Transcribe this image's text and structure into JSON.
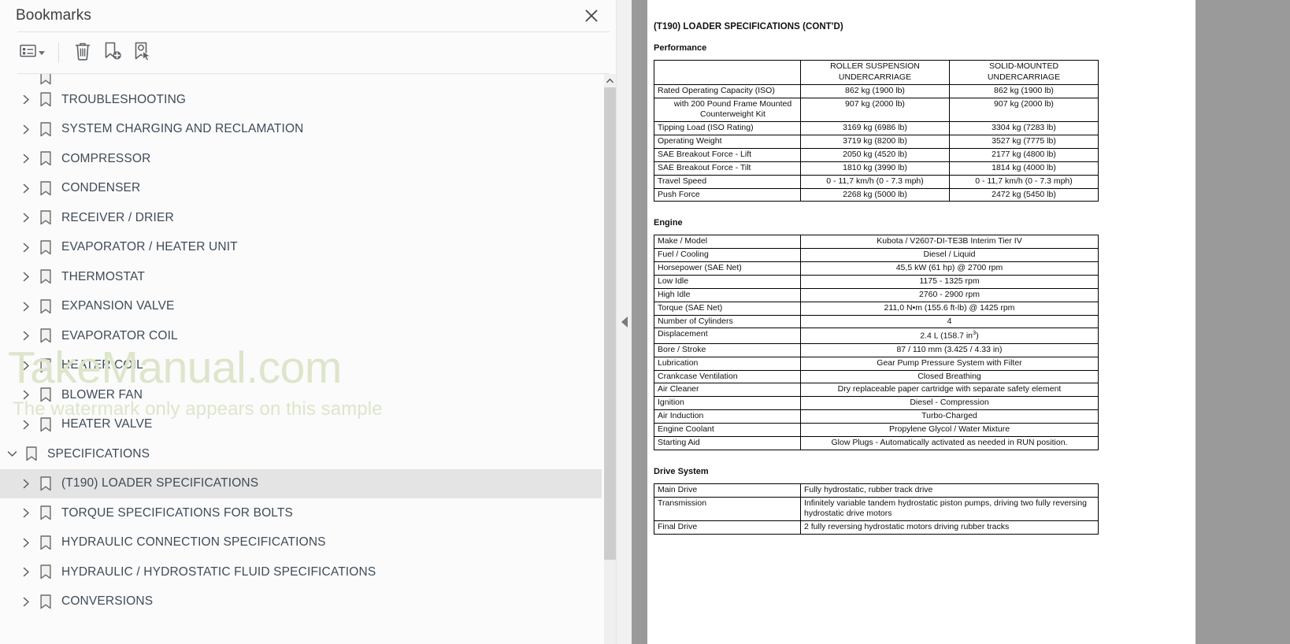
{
  "panel": {
    "title": "Bookmarks",
    "close_icon": "close-icon",
    "toolbar": [
      {
        "name": "bookmark-options-button",
        "icon": "list-options-icon",
        "has_caret": true
      },
      {
        "name": "delete-bookmark-button",
        "icon": "trash-icon",
        "has_caret": false
      },
      {
        "name": "new-bookmark-button",
        "icon": "bookmark-add-icon",
        "has_caret": false
      },
      {
        "name": "bookmark-destination-button",
        "icon": "bookmark-pointer-icon",
        "has_caret": false
      }
    ]
  },
  "watermark": {
    "main": "TakeManual.com",
    "sub": "The watermark only appears on this sample"
  },
  "tree": {
    "items": [
      {
        "label": "",
        "level": 1,
        "state": "collapsed",
        "selected": false,
        "clipped": true
      },
      {
        "label": "TROUBLESHOOTING",
        "level": 1,
        "state": "collapsed",
        "selected": false
      },
      {
        "label": "SYSTEM CHARGING AND RECLAMATION",
        "level": 1,
        "state": "collapsed",
        "selected": false
      },
      {
        "label": "COMPRESSOR",
        "level": 1,
        "state": "collapsed",
        "selected": false
      },
      {
        "label": "CONDENSER",
        "level": 1,
        "state": "collapsed",
        "selected": false
      },
      {
        "label": "RECEIVER / DRIER",
        "level": 1,
        "state": "collapsed",
        "selected": false
      },
      {
        "label": "EVAPORATOR / HEATER UNIT",
        "level": 1,
        "state": "collapsed",
        "selected": false
      },
      {
        "label": "THERMOSTAT",
        "level": 1,
        "state": "collapsed",
        "selected": false
      },
      {
        "label": "EXPANSION VALVE",
        "level": 1,
        "state": "collapsed",
        "selected": false
      },
      {
        "label": "EVAPORATOR COIL",
        "level": 1,
        "state": "collapsed",
        "selected": false
      },
      {
        "label": "HEATER COIL",
        "level": 1,
        "state": "collapsed",
        "selected": false
      },
      {
        "label": "BLOWER FAN",
        "level": 1,
        "state": "collapsed",
        "selected": false
      },
      {
        "label": "HEATER VALVE",
        "level": 1,
        "state": "collapsed",
        "selected": false
      },
      {
        "label": "SPECIFICATIONS",
        "level": 0,
        "state": "expanded",
        "selected": false
      },
      {
        "label": "(T190) LOADER SPECIFICATIONS",
        "level": 1,
        "state": "collapsed",
        "selected": true
      },
      {
        "label": "TORQUE SPECIFICATIONS FOR BOLTS",
        "level": 1,
        "state": "collapsed",
        "selected": false
      },
      {
        "label": "HYDRAULIC CONNECTION SPECIFICATIONS",
        "level": 1,
        "state": "collapsed",
        "selected": false
      },
      {
        "label": "HYDRAULIC / HYDROSTATIC FLUID SPECIFICATIONS",
        "level": 1,
        "state": "collapsed",
        "selected": false
      },
      {
        "label": "CONVERSIONS",
        "level": 1,
        "state": "collapsed",
        "selected": false
      }
    ]
  },
  "document": {
    "heading": "(T190) LOADER SPECIFICATIONS (CONT'D)",
    "performance": {
      "section_title": "Performance",
      "columns": [
        "",
        "ROLLER SUSPENSION UNDERCARRIAGE",
        "SOLID-MOUNTED UNDERCARRIAGE"
      ],
      "rows": [
        {
          "label": "Rated Operating Capacity (ISO)",
          "indent": false,
          "values": [
            "862 kg (1900 lb)",
            "862 kg (1900 lb)"
          ]
        },
        {
          "label": "with 200 Pound Frame Mounted Counterweight Kit",
          "indent": true,
          "values": [
            "907 kg (2000 lb)",
            "907 kg (2000 lb)"
          ]
        },
        {
          "label": "Tipping Load (ISO Rating)",
          "indent": false,
          "values": [
            "3169 kg (6986 lb)",
            "3304 kg (7283 lb)"
          ]
        },
        {
          "label": "Operating Weight",
          "indent": false,
          "values": [
            "3719 kg (8200 lb)",
            "3527 kg (7775 lb)"
          ]
        },
        {
          "label": "SAE Breakout Force - Lift",
          "indent": false,
          "values": [
            "2050 kg (4520 lb)",
            "2177 kg (4800 lb)"
          ]
        },
        {
          "label": "SAE Breakout Force - Tilt",
          "indent": false,
          "values": [
            "1810 kg (3990 lb)",
            "1814 kg (4000 lb)"
          ]
        },
        {
          "label": "Travel Speed",
          "indent": false,
          "values": [
            "0 - 11,7 km/h (0 - 7.3 mph)",
            "0 - 11,7 km/h (0 - 7.3 mph)"
          ]
        },
        {
          "label": "Push Force",
          "indent": false,
          "values": [
            "2268 kg (5000 lb)",
            "2472 kg (5450 lb)"
          ]
        }
      ]
    },
    "engine": {
      "section_title": "Engine",
      "rows": [
        {
          "label": "Make / Model",
          "value": "Kubota / V2607-DI-TE3B Interim Tier IV"
        },
        {
          "label": "Fuel / Cooling",
          "value": "Diesel / Liquid"
        },
        {
          "label": "Horsepower (SAE Net)",
          "value": "45,5 kW (61 hp) @ 2700 rpm"
        },
        {
          "label": "Low Idle",
          "value": "1175 - 1325 rpm"
        },
        {
          "label": "High Idle",
          "value": "2760 - 2900 rpm"
        },
        {
          "label": "Torque (SAE Net)",
          "value": "211,0 N•m (155.6 ft-lb) @ 1425 rpm"
        },
        {
          "label": "Number of Cylinders",
          "value": "4"
        },
        {
          "label": "Displacement",
          "value": "2.4 L (158.7 in3)",
          "superscript": "3",
          "value_base": "2.4 L (158.7 in",
          "value_tail": ")"
        },
        {
          "label": "Bore / Stroke",
          "value": "87 / 110 mm (3.425 / 4.33 in)"
        },
        {
          "label": "Lubrication",
          "value": "Gear Pump Pressure System with Filter"
        },
        {
          "label": "Crankcase Ventilation",
          "value": "Closed Breathing"
        },
        {
          "label": "Air Cleaner",
          "value": "Dry replaceable paper cartridge with separate safety element"
        },
        {
          "label": "Ignition",
          "value": "Diesel - Compression"
        },
        {
          "label": "Air Induction",
          "value": "Turbo-Charged"
        },
        {
          "label": "Engine Coolant",
          "value": "Propylene Glycol / Water Mixture"
        },
        {
          "label": "Starting Aid",
          "value": "Glow Plugs - Automatically activated as needed in RUN position."
        }
      ]
    },
    "drive_system": {
      "section_title": "Drive System",
      "rows": [
        {
          "label": "Main Drive",
          "value": "Fully hydrostatic, rubber track drive"
        },
        {
          "label": "Transmission",
          "value": "Infinitely variable tandem hydrostatic piston pumps, driving two fully reversing hydrostatic drive motors"
        },
        {
          "label": "Final Drive",
          "value": "2 fully reversing hydrostatic motors driving rubber tracks"
        }
      ]
    }
  },
  "colors": {
    "panel_bg": "#fbfbfb",
    "doc_bg": "#9a9a9a",
    "selection": "#e4e4e4",
    "watermark": "#dde5cb",
    "label_text": "#3f4b58"
  }
}
